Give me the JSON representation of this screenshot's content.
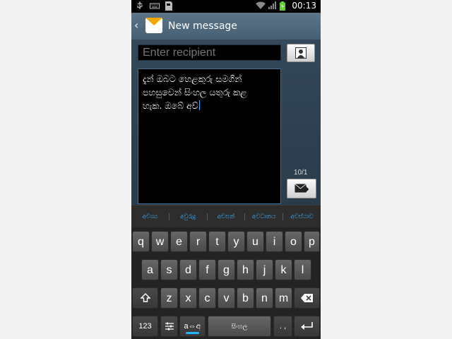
{
  "status_bar": {
    "time": "00:13",
    "icons": [
      "usb-icon",
      "keyboard-icon",
      "sd-card-icon",
      "wifi-icon",
      "signal-icon",
      "battery-icon"
    ]
  },
  "action_bar": {
    "title": "New message",
    "back_icon": "chevron-left-icon",
    "app_icon": "envelope-icon"
  },
  "compose": {
    "recipient_placeholder": "Enter recipient",
    "message_lines": [
      "දැන් ඔබට හෙළකුරු සමගින්",
      "පහසුවෙන් සිංහල යතුරු කළ",
      "හැක. ඔබේ අව්"
    ],
    "counter": "10/1",
    "contact_icon": "contact-card-icon",
    "send_icon": "send-message-icon"
  },
  "suggestions": [
    "අවශ්‍ය",
    "අවුරුදු",
    "අවසන්",
    "අවධානය",
    "අවස්ථාව"
  ],
  "keyboard": {
    "row1": [
      "q",
      "w",
      "e",
      "r",
      "t",
      "y",
      "u",
      "i",
      "o",
      "p"
    ],
    "row2": [
      "a",
      "s",
      "d",
      "f",
      "g",
      "h",
      "j",
      "k",
      "l"
    ],
    "row3": [
      "z",
      "x",
      "c",
      "v",
      "b",
      "n",
      "m"
    ],
    "shift_icon": "shift-icon",
    "backspace_icon": "backspace-icon",
    "numbers_label": "123",
    "settings_icon": "settings-icon",
    "lang_switch_label": "a⇔අ",
    "space_label": "සිංහල",
    "punct_label": ". ,",
    "enter_icon": "enter-icon"
  },
  "colors": {
    "action_bar": "#52697d",
    "compose_bg": "#2f4252",
    "accent": "#3db4ff",
    "key": "#595959"
  }
}
